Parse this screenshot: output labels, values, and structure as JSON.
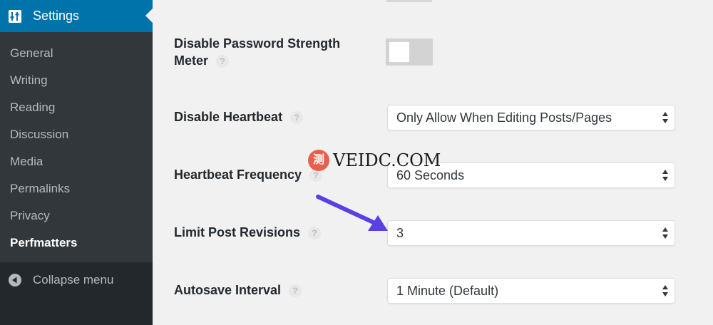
{
  "sidebar": {
    "header_title": "Settings",
    "items": [
      {
        "label": "General"
      },
      {
        "label": "Writing"
      },
      {
        "label": "Reading"
      },
      {
        "label": "Discussion"
      },
      {
        "label": "Media"
      },
      {
        "label": "Permalinks"
      },
      {
        "label": "Privacy"
      },
      {
        "label": "Perfmatters"
      }
    ],
    "collapse_label": "Collapse menu"
  },
  "settings": {
    "password_meter": {
      "label_line1": "Disable Password Strength",
      "label_line2": "Meter",
      "help": "?"
    },
    "heartbeat": {
      "label": "Disable Heartbeat",
      "help": "?",
      "value": "Only Allow When Editing Posts/Pages"
    },
    "heartbeat_frequency": {
      "label": "Heartbeat Frequency",
      "help": "?",
      "value": "60 Seconds"
    },
    "post_revisions": {
      "label": "Limit Post Revisions",
      "help": "?",
      "value": "3"
    },
    "autosave": {
      "label": "Autosave Interval",
      "help": "?",
      "value": "1 Minute (Default)"
    }
  },
  "watermark": {
    "badge": "测",
    "text": "VEIDC.COM"
  },
  "colors": {
    "sidebar_bg": "#23282d",
    "submenu_bg": "#32373c",
    "accent": "#0073aa",
    "arrow": "#5b3fe6"
  }
}
